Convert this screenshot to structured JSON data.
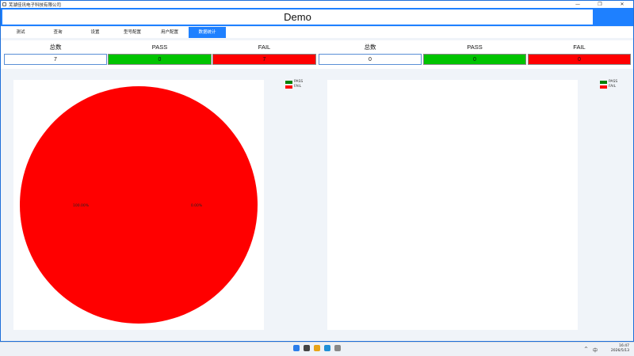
{
  "window": {
    "title": "芜湖佳讯电子科技有限公司"
  },
  "window_controls": {
    "minimize": "—",
    "maximize": "❐",
    "close": "✕"
  },
  "header": {
    "title": "Demo"
  },
  "tabs": [
    {
      "label": "测试"
    },
    {
      "label": "查询"
    },
    {
      "label": "设置"
    },
    {
      "label": "型号配置"
    },
    {
      "label": "用户配置"
    },
    {
      "label": "数据统计"
    }
  ],
  "stats": {
    "left": {
      "total_label": "总数",
      "pass_label": "PASS",
      "fail_label": "FAIL",
      "total": "7",
      "pass": "0",
      "fail": "7"
    },
    "right": {
      "total_label": "总数",
      "pass_label": "PASS",
      "fail_label": "FAIL",
      "total": "0",
      "pass": "0",
      "fail": "0"
    }
  },
  "colors": {
    "accent": "#1e80ff",
    "pass": "#00c400",
    "fail": "#ff0000"
  },
  "chart_data": [
    {
      "type": "pie",
      "categories": [
        "PASS",
        "FAIL"
      ],
      "values": [
        0,
        7
      ],
      "slice_labels": [
        "100.00%",
        "0.00%"
      ],
      "colors": [
        "#008000",
        "#ff0000"
      ],
      "legend": "top-right",
      "title": ""
    },
    {
      "type": "pie",
      "categories": [
        "PASS",
        "FAIL"
      ],
      "values": [
        0,
        0
      ],
      "colors": [
        "#008000",
        "#ff0000"
      ],
      "legend": "top-right",
      "title": ""
    }
  ],
  "taskbar": {
    "icons": [
      "windows-start-icon",
      "explorer-icon",
      "chrome-icon",
      "edge-icon",
      "app-icon"
    ],
    "tray": {
      "expand": "^",
      "input_method": "中"
    },
    "clock": {
      "time": "16:47",
      "date": "2026/5/13"
    }
  }
}
